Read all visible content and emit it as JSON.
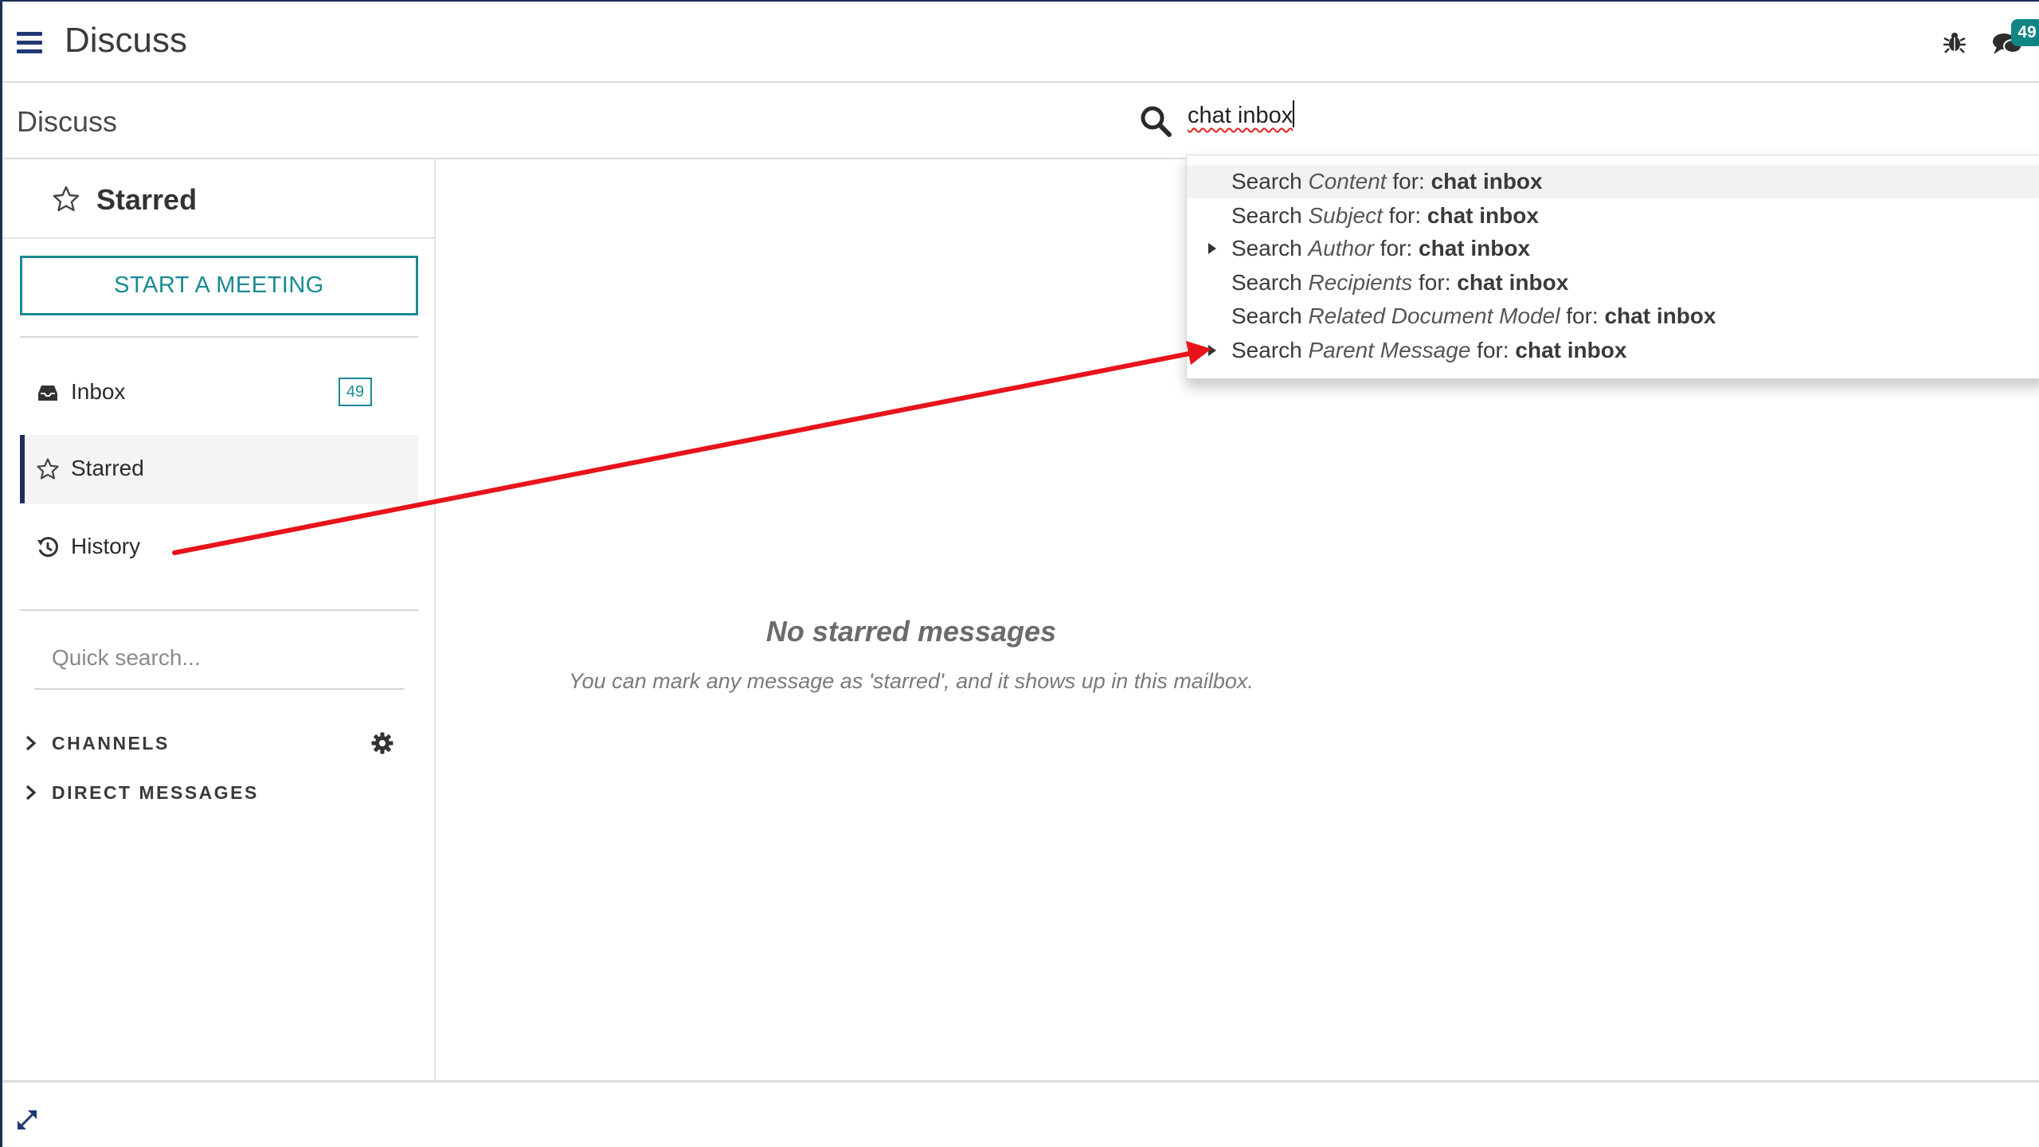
{
  "navbar": {
    "app_title": "Discuss",
    "menu_icon": "hamburger-menu-icon",
    "debug_icon": "bug-icon",
    "messaging_icon": "chat-bubbles-icon",
    "messaging_badge": "49"
  },
  "control_panel": {
    "breadcrumb": "Discuss",
    "search_icon": "search-icon",
    "search_value": "chat inbox"
  },
  "search_suggestions": [
    {
      "prefix": "Search ",
      "field": "Content",
      "for": " for: ",
      "term": "chat inbox",
      "expandable": false,
      "focused": true
    },
    {
      "prefix": "Search ",
      "field": "Subject",
      "for": " for: ",
      "term": "chat inbox",
      "expandable": false,
      "focused": false
    },
    {
      "prefix": "Search ",
      "field": "Author",
      "for": " for: ",
      "term": "chat inbox",
      "expandable": true,
      "focused": false
    },
    {
      "prefix": "Search ",
      "field": "Recipients",
      "for": " for: ",
      "term": "chat inbox",
      "expandable": false,
      "focused": false
    },
    {
      "prefix": "Search ",
      "field": "Related Document Model",
      "for": " for: ",
      "term": "chat inbox",
      "expandable": false,
      "focused": false
    },
    {
      "prefix": "Search ",
      "field": "Parent Message",
      "for": " for: ",
      "term": "chat inbox",
      "expandable": true,
      "focused": false
    }
  ],
  "sidebar": {
    "header_title": "Starred",
    "header_icon": "star-outline-icon",
    "start_meeting_label": "START A MEETING",
    "mailboxes": [
      {
        "label": "Inbox",
        "icon": "inbox-tray-icon",
        "counter": "49",
        "active": false
      },
      {
        "label": "Starred",
        "icon": "star-outline-icon",
        "counter": "",
        "active": true
      },
      {
        "label": "History",
        "icon": "history-icon",
        "counter": "",
        "active": false
      }
    ],
    "quick_search_placeholder": "Quick search...",
    "categories": [
      {
        "label": "CHANNELS",
        "icon": "chevron-right-icon",
        "has_settings": true,
        "settings_icon": "gear-icon"
      },
      {
        "label": "DIRECT MESSAGES",
        "icon": "chevron-right-icon",
        "has_settings": false
      }
    ]
  },
  "content": {
    "empty_title": "No starred messages",
    "empty_text": "You can mark any message as 'starred', and it shows up in this mailbox."
  },
  "footer": {
    "expand_icon": "expand-arrows-icon"
  },
  "colors": {
    "accent_teal": "#1a8a92",
    "badge_teal": "#0f8585",
    "nav_blue": "#1f3a73",
    "annotation_red": "#e8141b"
  }
}
